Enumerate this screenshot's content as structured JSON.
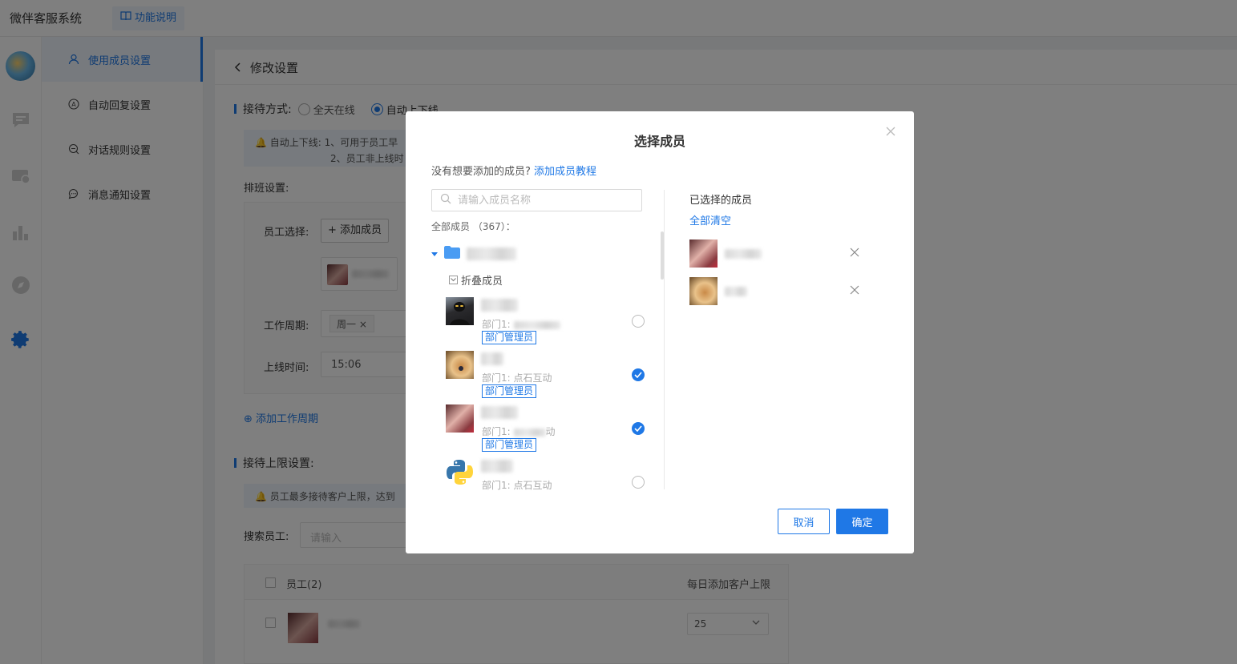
{
  "app": {
    "title": "微伴客服系统",
    "func_btn": "功能说明"
  },
  "submenu": {
    "items": [
      {
        "label": "使用成员设置",
        "icon": "user-icon"
      },
      {
        "label": "自动回复设置",
        "icon": "auto-reply-icon"
      },
      {
        "label": "对话规则设置",
        "icon": "chat-rule-icon"
      },
      {
        "label": "消息通知设置",
        "icon": "message-icon"
      }
    ]
  },
  "main": {
    "back_title": "修改设置",
    "reception_label": "接待方式:",
    "option_all_day": "全天在线",
    "option_auto": "自动上下线",
    "notice1_line1": "自动上下线: 1、可用于员工早",
    "notice1_line2": "2、员工非上线时",
    "schedule_label": "排班设置:",
    "staff_select_label": "员工选择:",
    "add_staff_btn": "添加成员",
    "work_cycle_label": "工作周期:",
    "work_day": "周一",
    "online_time_label": "上线时间:",
    "online_time": "15:06",
    "add_cycle_link": "添加工作周期",
    "limit_label": "接待上限设置:",
    "notice2": "员工最多接待客户上限，达到",
    "search_staff_label": "搜索员工:",
    "search_staff_placeholder": "请输入",
    "table_col_staff": "员工(2)",
    "table_col_limit": "每日添加客户上限",
    "table_row_limit": "25"
  },
  "modal": {
    "title": "选择成员",
    "hint": "没有想要添加的成员?",
    "hint_link": "添加成员教程",
    "search_placeholder": "请输入成员名称",
    "all_members": "全部成员",
    "count": "（367）：",
    "collapse": "折叠成员",
    "members": [
      {
        "dept": "部门1:",
        "tag": "部门管理员",
        "checked": false
      },
      {
        "dept": "部门1: 点石互动",
        "tag": "部门管理员",
        "checked": true
      },
      {
        "dept": "部门1:",
        "dept_tail": "动",
        "tag": "部门管理员",
        "checked": true
      },
      {
        "dept": "部门1: 点石互动",
        "tag": "",
        "checked": false
      }
    ],
    "selected_title": "已选择的成员",
    "clear_all": "全部清空",
    "cancel": "取消",
    "ok": "确定"
  },
  "colors": {
    "accent": "#1f78e6"
  }
}
